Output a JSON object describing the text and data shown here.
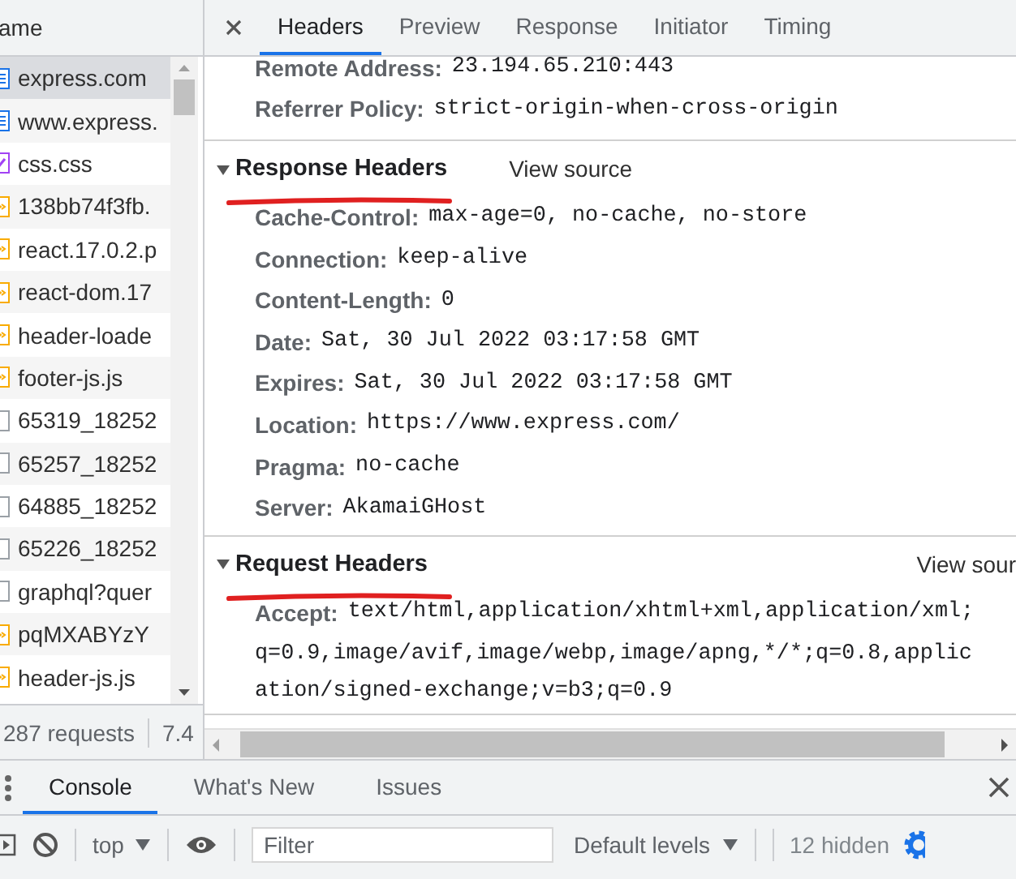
{
  "file_list": {
    "header": "ame",
    "items": [
      {
        "name": "express.com",
        "kind": "document",
        "selected": true
      },
      {
        "name": "www.express.",
        "kind": "document",
        "selected": false
      },
      {
        "name": "css.css",
        "kind": "stylesheet",
        "selected": false
      },
      {
        "name": "138bb74f3fb.",
        "kind": "script",
        "selected": false
      },
      {
        "name": "react.17.0.2.p",
        "kind": "script",
        "selected": false
      },
      {
        "name": "react-dom.17",
        "kind": "script",
        "selected": false
      },
      {
        "name": "header-loade",
        "kind": "script",
        "selected": false
      },
      {
        "name": "footer-js.js",
        "kind": "script",
        "selected": false
      },
      {
        "name": "65319_18252",
        "kind": "other",
        "selected": false
      },
      {
        "name": "65257_18252",
        "kind": "other",
        "selected": false
      },
      {
        "name": "64885_18252",
        "kind": "other",
        "selected": false
      },
      {
        "name": "65226_18252",
        "kind": "other",
        "selected": false
      },
      {
        "name": "graphql?quer",
        "kind": "other",
        "selected": false
      },
      {
        "name": "pqMXABYzY",
        "kind": "script",
        "selected": false
      },
      {
        "name": "header-js.js",
        "kind": "script",
        "selected": false
      }
    ],
    "requests": "287 requests",
    "size": "7.4"
  },
  "detail_tabs": [
    {
      "label": "Headers",
      "selected": true
    },
    {
      "label": "Preview",
      "selected": false
    },
    {
      "label": "Response",
      "selected": false
    },
    {
      "label": "Initiator",
      "selected": false
    },
    {
      "label": "Timing",
      "selected": false
    }
  ],
  "general": [
    {
      "name": "Remote Address:",
      "value": "23.194.65.210:443"
    },
    {
      "name": "Referrer Policy:",
      "value": "strict-origin-when-cross-origin"
    }
  ],
  "sections": [
    {
      "title": "Response Headers",
      "view_source": "View source",
      "expanded": true,
      "underlined": true,
      "headers": [
        {
          "name": "Cache-Control:",
          "value": "max-age=0, no-cache, no-store"
        },
        {
          "name": "Connection:",
          "value": "keep-alive"
        },
        {
          "name": "Content-Length:",
          "value": "0"
        },
        {
          "name": "Date:",
          "value": "Sat, 30 Jul 2022 03:17:58 GMT"
        },
        {
          "name": "Expires:",
          "value": "Sat, 30 Jul 2022 03:17:58 GMT"
        },
        {
          "name": "Location:",
          "value": "https://www.express.com/"
        },
        {
          "name": "Pragma:",
          "value": "no-cache"
        },
        {
          "name": "Server:",
          "value": "AkamaiGHost"
        }
      ]
    },
    {
      "title": "Request Headers",
      "view_source": "View sour",
      "expanded": true,
      "underlined": true,
      "headers": [
        {
          "name": "Accept:",
          "value": "text/html,application/xhtml+xml,application/xml;",
          "more": [
            "q=0.9,image/avif,image/webp,image/apng,*/*;q=0.8,applic",
            "ation/signed-exchange;v=b3;q=0.9"
          ]
        }
      ]
    }
  ],
  "drawer": {
    "tabs": [
      {
        "label": "Console",
        "selected": true
      },
      {
        "label": "What's New",
        "selected": false
      },
      {
        "label": "Issues",
        "selected": false
      }
    ],
    "context": "top",
    "filter_placeholder": "Filter",
    "levels": "Default levels",
    "hidden": "12 hidden"
  }
}
